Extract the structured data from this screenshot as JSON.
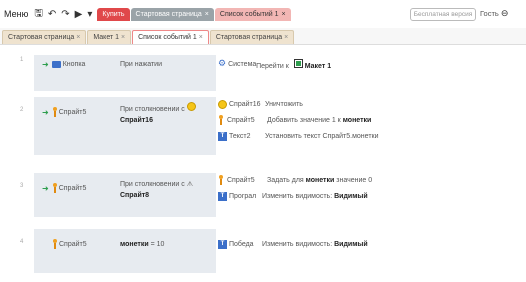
{
  "toolbar": {
    "menu": "Меню",
    "top_tabs": [
      {
        "label": "Купить",
        "style": "red"
      },
      {
        "label": "Стартовая страница",
        "style": "gray"
      },
      {
        "label": "Список событий 1",
        "style": "pink"
      }
    ],
    "pill": "Бесплатная версия",
    "guest": "Гость"
  },
  "tabs": [
    {
      "label": "Стартовая страница"
    },
    {
      "label": "Макет 1"
    },
    {
      "label": "Список событий 1"
    },
    {
      "label": "Стартовая страница"
    }
  ],
  "events": [
    {
      "number": "1",
      "condition": {
        "object": "Кнопка",
        "text": "При нажатии"
      },
      "actions": [
        {
          "object": "Система",
          "text_pre": "Перейти к",
          "text_bold": "Макет 1",
          "text_post": ""
        }
      ]
    },
    {
      "number": "2",
      "condition": {
        "object": "Спрайт5",
        "text": "При столкновении с",
        "target": "Спрайт16"
      },
      "actions": [
        {
          "object": "Спрайт16",
          "text_pre": "Уничтожить",
          "text_bold": "",
          "text_post": ""
        },
        {
          "object": "Спрайт5",
          "text_pre": "Добавить значение 1 к",
          "text_bold": "монетки",
          "text_post": ""
        },
        {
          "object": "Текст2",
          "text_pre": "Установить текст Спрайт5.монетки",
          "text_bold": "",
          "text_post": ""
        }
      ]
    },
    {
      "number": "3",
      "condition": {
        "object": "Спрайт5",
        "text": "При столкновении с",
        "target": "Спрайт8"
      },
      "actions": [
        {
          "object": "Спрайт5",
          "text_pre": "Задать для",
          "text_bold": "монетки",
          "text_post": "значение 0"
        },
        {
          "object": "Програл",
          "text_pre": "Изменить видимость:",
          "text_bold": "Видимый",
          "text_post": ""
        }
      ]
    },
    {
      "number": "4",
      "condition": {
        "object": "Спрайт5",
        "text_bold": "монетки",
        "text": "= 10"
      },
      "actions": [
        {
          "object": "Победа",
          "text_pre": "Изменить видимость:",
          "text_bold": "Видимый",
          "text_post": ""
        }
      ]
    }
  ]
}
